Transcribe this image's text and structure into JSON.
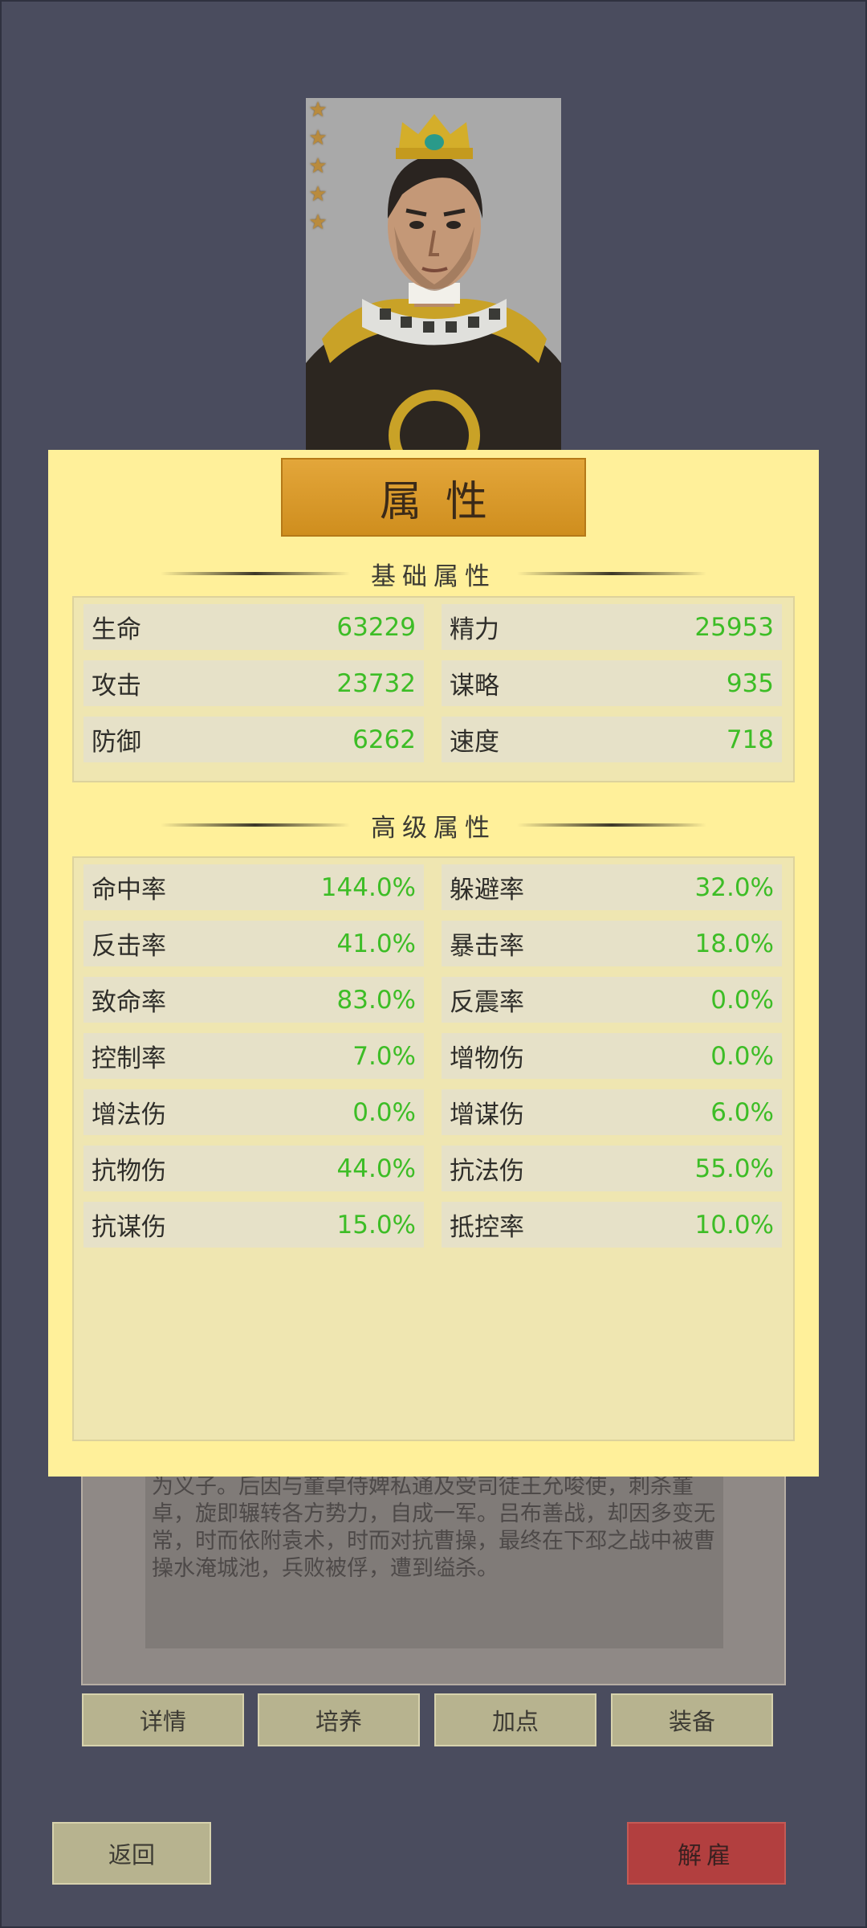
{
  "dialog": {
    "title": "属性",
    "basic_header": "基础属性",
    "advanced_header": "高级属性"
  },
  "hero": {
    "stars": 5,
    "portrait_icon": "general-portrait"
  },
  "basic_stats": [
    {
      "label": "生命",
      "value": "63229"
    },
    {
      "label": "精力",
      "value": "25953"
    },
    {
      "label": "攻击",
      "value": "23732"
    },
    {
      "label": "谋略",
      "value": "935"
    },
    {
      "label": "防御",
      "value": "6262"
    },
    {
      "label": "速度",
      "value": "718"
    }
  ],
  "advanced_stats": [
    {
      "label": "命中率",
      "value": "144.0%"
    },
    {
      "label": "躲避率",
      "value": "32.0%"
    },
    {
      "label": "反击率",
      "value": "41.0%"
    },
    {
      "label": "暴击率",
      "value": "18.0%"
    },
    {
      "label": "致命率",
      "value": "83.0%"
    },
    {
      "label": "反震率",
      "value": "0.0%"
    },
    {
      "label": "控制率",
      "value": "7.0%"
    },
    {
      "label": "增物伤",
      "value": "0.0%"
    },
    {
      "label": "增法伤",
      "value": "0.0%"
    },
    {
      "label": "增谋伤",
      "value": "6.0%"
    },
    {
      "label": "抗物伤",
      "value": "44.0%"
    },
    {
      "label": "抗法伤",
      "value": "55.0%"
    },
    {
      "label": "抗谋伤",
      "value": "15.0%"
    },
    {
      "label": "抵控率",
      "value": "10.0%"
    }
  ],
  "bio": {
    "text": "为义子。后因与董卓侍婢私通及受司徒王允唆使，刺杀董卓，旋即辗转各方势力，自成一军。吕布善战，却因多变无常，时而依附袁术，时而对抗曹操，最终在下邳之战中被曹操水淹城池，兵败被俘，遭到缢杀。"
  },
  "tabs": {
    "details": "详情",
    "train": "培养",
    "points": "加点",
    "equip": "装备"
  },
  "footer": {
    "back": "返回",
    "dismiss": "解雇"
  },
  "colors": {
    "background": "#4a4c5e",
    "dialog": "#fff09a",
    "stat_value": "#3dbd26",
    "dismiss_button": "#b23f3f"
  }
}
